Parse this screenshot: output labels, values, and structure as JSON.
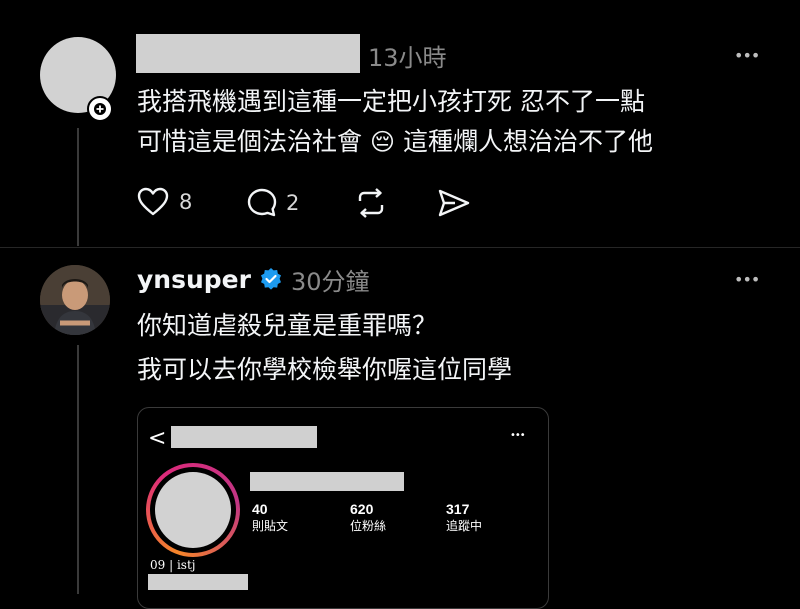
{
  "post1": {
    "time": "13小時",
    "text_line1": "我搭飛機遇到這種一定把小孩打死 忍不了一點",
    "text_line2_a": "可惜這是個法治社會",
    "emoji": "😔",
    "text_line2_b": "這種爛人想治治不了他",
    "likes": "8",
    "replies": "2",
    "more": "•••"
  },
  "post2": {
    "username": "ynsuper",
    "time": "30分鐘",
    "text_line1": "你知道虐殺兒童是重罪嗎？",
    "text_line2": "我可以去你學校檢舉你喔這位同學",
    "more": "•••"
  },
  "embed": {
    "back": "<",
    "more": "•••",
    "stats": [
      {
        "value": "40",
        "label": "則貼文"
      },
      {
        "value": "620",
        "label": "位粉絲"
      },
      {
        "value": "317",
        "label": "追蹤中"
      }
    ],
    "bio": "09 | istj"
  },
  "colors": {
    "background": "#000000",
    "verified": "#1d9bf0",
    "ring_start": "#f58529",
    "ring_end": "#c13584"
  },
  "icons": [
    "heart-icon",
    "comment-icon",
    "repost-icon",
    "share-icon",
    "verified-icon",
    "more-icon",
    "back-icon"
  ]
}
